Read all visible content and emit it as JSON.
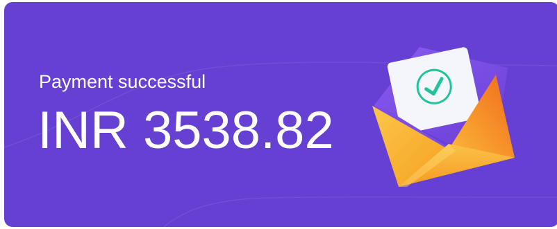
{
  "payment": {
    "status_label": "Payment successful",
    "amount_text": "INR 3538.82"
  },
  "illustration": {
    "icon": "envelope-check-icon",
    "colors": {
      "card_background": "#6640d2",
      "envelope_orange": "#f28a1a",
      "envelope_yellow": "#fbbf3a",
      "letter": "#f4f6fb",
      "check": "#1fbf9a"
    }
  }
}
